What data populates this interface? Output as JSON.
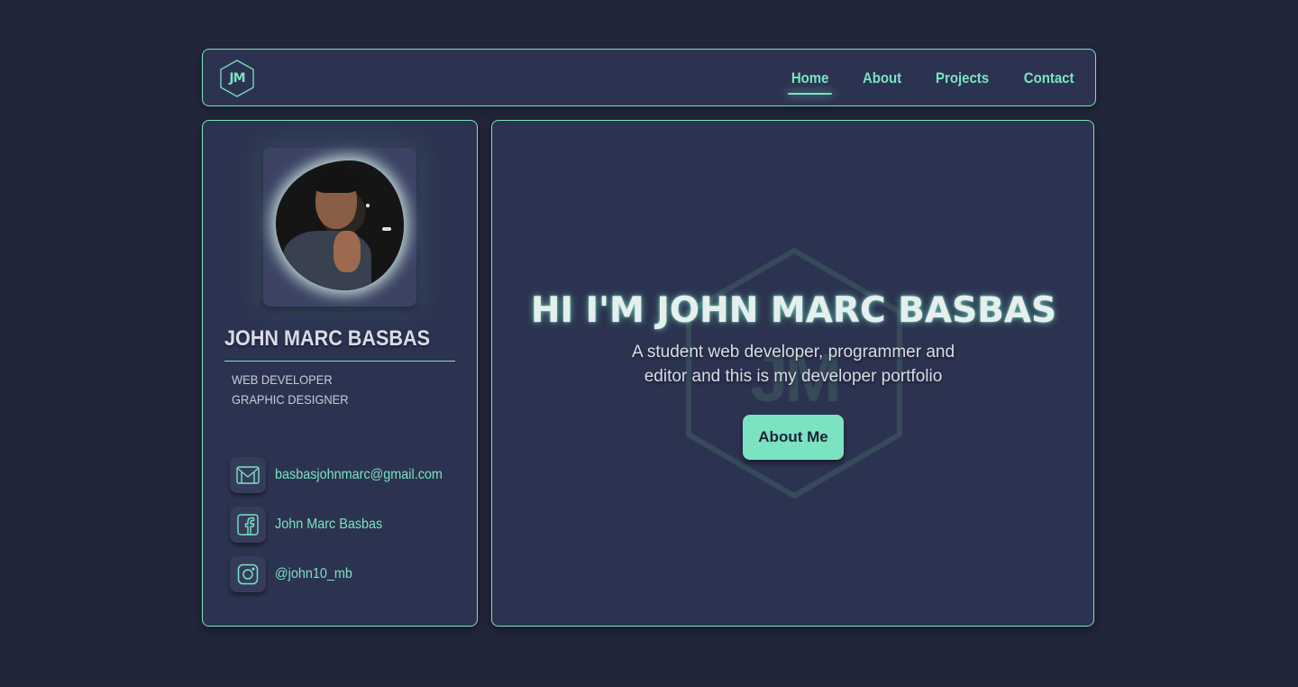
{
  "nav": {
    "logo_text": "JM",
    "links": [
      {
        "label": "Home",
        "active": true
      },
      {
        "label": "About",
        "active": false
      },
      {
        "label": "Projects",
        "active": false
      },
      {
        "label": "Contact",
        "active": false
      }
    ]
  },
  "profile": {
    "name": "JOHN MARC BASBAS",
    "roles": [
      "WEB DEVELOPER",
      "GRAPHIC DESIGNER"
    ],
    "contacts": [
      {
        "icon": "gmail-icon",
        "label": "basbasjohnmarc@gmail.com"
      },
      {
        "icon": "facebook-icon",
        "label": "John Marc Basbas"
      },
      {
        "icon": "instagram-icon",
        "label": "@john10_mb"
      }
    ]
  },
  "hero": {
    "watermark_text": "JM",
    "headline": "HI I'M JOHN MARC BASBAS",
    "subtitle": "A student web developer, programmer and editor and this is my developer portfolio",
    "button_label": "About Me"
  },
  "colors": {
    "background": "#22263b",
    "panel": "#2c3350",
    "accent": "#7be3c2",
    "text": "#d9dbe6"
  }
}
